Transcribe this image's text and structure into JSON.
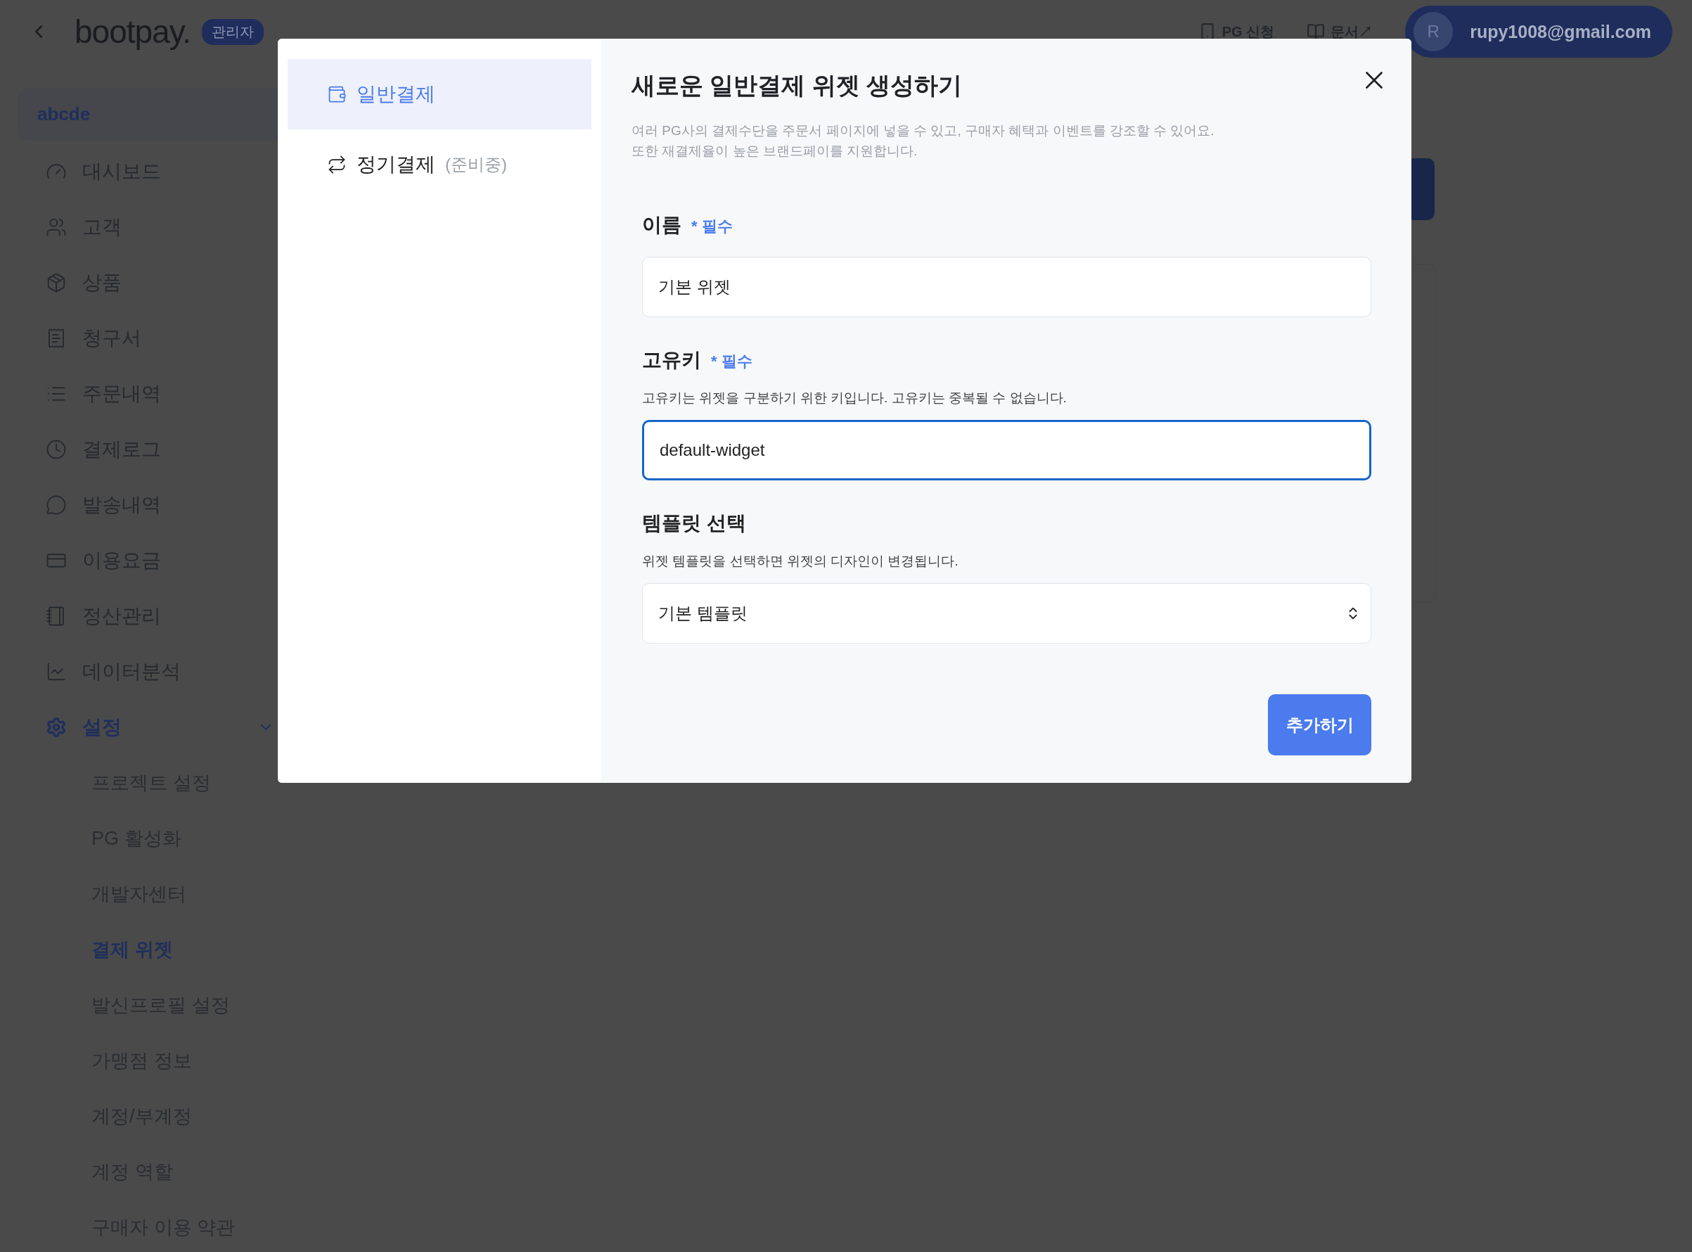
{
  "header": {
    "logo": "bootpay.",
    "badge": "관리자",
    "links": [
      {
        "label": "PG 신청"
      },
      {
        "label": "문서↗"
      }
    ],
    "user": {
      "initial": "R",
      "email": "rupy1008@gmail.com"
    }
  },
  "sidebar": {
    "project": "abcde",
    "items": [
      {
        "label": "대시보드",
        "selected": false
      },
      {
        "label": "고객",
        "selected": false
      },
      {
        "label": "상품",
        "selected": false
      },
      {
        "label": "청구서",
        "selected": false
      },
      {
        "label": "주문내역",
        "selected": false
      },
      {
        "label": "결제로그",
        "selected": false
      },
      {
        "label": "발송내역",
        "selected": false
      },
      {
        "label": "이용요금",
        "selected": false
      },
      {
        "label": "정산관리",
        "selected": false
      },
      {
        "label": "데이터분석",
        "selected": false
      },
      {
        "label": "설정",
        "selected": true,
        "expanded": true,
        "children": [
          {
            "label": "프로젝트 설정",
            "selected": false
          },
          {
            "label": "PG 활성화",
            "selected": false
          },
          {
            "label": "개발자센터",
            "selected": false
          },
          {
            "label": "결제 위젯",
            "selected": true
          },
          {
            "label": "발신프로필 설정",
            "selected": false
          },
          {
            "label": "가맹점 정보",
            "selected": false
          },
          {
            "label": "계정/부계정",
            "selected": false
          },
          {
            "label": "계정 역할",
            "selected": false
          },
          {
            "label": "구매자 이용 약관",
            "selected": false
          }
        ]
      }
    ]
  },
  "modal": {
    "tabs": [
      {
        "label": "일반결제",
        "selected": true
      },
      {
        "label": "정기결제",
        "note": "(준비중)",
        "selected": false
      }
    ],
    "title": "새로운 일반결제 위젯 생성하기",
    "description": [
      "여러 PG사의 결제수단을 주문서 페이지에 넣을 수 있고, 구매자 혜택과 이벤트를 강조할 수 있어요.",
      "또한 재결제율이 높은 브랜드페이를 지원합니다."
    ],
    "fields": [
      {
        "kind": "text",
        "label": "이름",
        "required": "* 필수",
        "value": "기본 위젯",
        "focused": false
      },
      {
        "kind": "text",
        "label": "고유키",
        "required": "* 필수",
        "help": "고유키는 위젯을 구분하기 위한 키입니다. 고유키는 중복될 수 없습니다.",
        "value": "default-widget",
        "focused": true
      },
      {
        "kind": "select",
        "label": "템플릿 선택",
        "help": "위젯 템플릿을 선택하면 위젯의 디자인이 변경됩니다.",
        "value": "기본 템플릿",
        "focused": false
      }
    ],
    "submit": "추가하기"
  }
}
